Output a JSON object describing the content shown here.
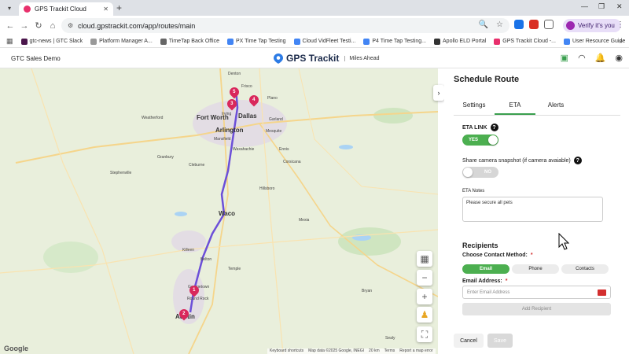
{
  "browser": {
    "tab_title": "GPS Trackit Cloud",
    "url": "cloud.gpstrackit.com/app/routes/main",
    "verify_label": "Verify it's you",
    "bookmarks": [
      {
        "label": "gtc-news | GTC Slack",
        "color": "#4a154b"
      },
      {
        "label": "Platform Manager A...",
        "color": "#999999"
      },
      {
        "label": "TimeTap Back Office",
        "color": "#666666"
      },
      {
        "label": "PX Time Tap Testing",
        "color": "#4285f4"
      },
      {
        "label": "Cloud VidFleet Testi...",
        "color": "#4285f4"
      },
      {
        "label": "P4 Time Tap Testing...",
        "color": "#4285f4"
      },
      {
        "label": "Apollo ELD Portal",
        "color": "#333333"
      },
      {
        "label": "GPS Trackit Cloud -...",
        "color": "#e8306c"
      },
      {
        "label": "User Resource Guide",
        "color": "#4285f4"
      }
    ]
  },
  "header": {
    "org_name": "GTC Sales Demo",
    "brand_name": "GPS Trackit",
    "tagline": "Miles Ahead"
  },
  "map": {
    "cities": [
      {
        "name": "Fort Worth"
      },
      {
        "name": "Dallas"
      },
      {
        "name": "Arlington"
      },
      {
        "name": "Waco"
      },
      {
        "name": "Austin"
      }
    ],
    "towns": [
      "Denton",
      "Frisco",
      "Plano",
      "Garland",
      "Mesquite",
      "Irving",
      "Mansfield",
      "Waxahachie",
      "Corsicana",
      "Killeen",
      "Temple",
      "Belton",
      "Georgetown",
      "Round Rock",
      "Hillsboro",
      "Cleburne",
      "Weatherford",
      "Granbury",
      "Stephenville",
      "Ennis",
      "Mexia",
      "Bryan",
      "Sealy"
    ],
    "pins": [
      "1",
      "2",
      "3",
      "4",
      "5"
    ],
    "attribution": [
      "Keyboard shortcuts",
      "Map data ©2025 Google, INEGI",
      "20 km",
      "Terms",
      "Report a map error"
    ],
    "google_label": "Google"
  },
  "panel": {
    "title": "Schedule Route",
    "tabs": [
      "Settings",
      "ETA",
      "Alerts"
    ],
    "active_tab": "ETA",
    "eta_link_label": "ETA LINK",
    "eta_link_value": "YES",
    "share_label": "Share camera snapshot (if camera avaiable)",
    "share_value": "NO",
    "notes_label": "ETA Notes",
    "notes_value": "Please secure all pets",
    "recipients_title": "Recipients",
    "contact_method_label": "Choose Contact Method:",
    "contact_methods": [
      "Email",
      "Phone",
      "Contacts"
    ],
    "active_method": "Email",
    "email_label": "Email Address:",
    "email_placeholder": "Enter Email Address",
    "add_recipient_label": "Add Recipient",
    "cancel_label": "Cancel",
    "save_label": "Save",
    "required_mark": "*"
  },
  "colors": {
    "accent": "#4caf50",
    "pin": "#d9285c",
    "brand": "#1b2a4a"
  }
}
